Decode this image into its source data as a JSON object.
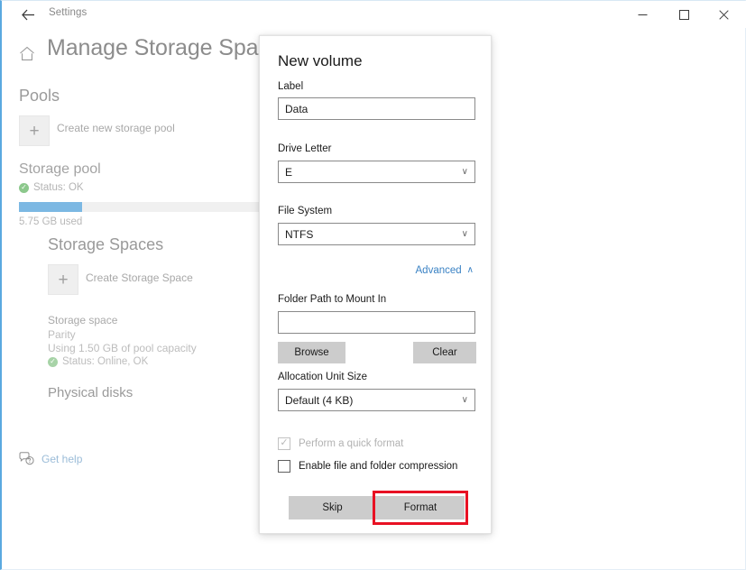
{
  "titlebar": {
    "back_icon": "back-arrow-icon",
    "app_title": "Settings",
    "minimize_label": "–",
    "maximize_label": "□",
    "close_label": "✕"
  },
  "header": {
    "home_icon": "home-icon",
    "page_title": "Manage Storage Spaces"
  },
  "main": {
    "pools_heading": "Pools",
    "create_pool": {
      "plus": "+",
      "label": "Create new storage pool"
    },
    "pool": {
      "name": "Storage pool",
      "status": "Status: OK",
      "status_check": "✓",
      "used_text": "5.75 GB used",
      "used_percent": 25
    },
    "spaces_heading": "Storage Spaces",
    "create_space": {
      "plus": "+",
      "label": "Create Storage Space"
    },
    "space": {
      "name": "Storage space",
      "type": "Parity",
      "capacity": "Using 1.50 GB of pool capacity",
      "status": "Status: Online, OK",
      "status_check": "✓"
    },
    "disks_heading": "Physical disks",
    "get_help": {
      "icon": "help-chat-icon",
      "label": "Get help"
    }
  },
  "dialog": {
    "title": "New volume",
    "label_field": {
      "label": "Label",
      "value": "Data",
      "placeholder": ""
    },
    "drive_letter_field": {
      "label": "Drive Letter",
      "value": "E",
      "chevron": "∨"
    },
    "file_system_field": {
      "label": "File System",
      "value": "NTFS",
      "chevron": "∨"
    },
    "advanced": {
      "label": "Advanced",
      "chevron": "∧"
    },
    "folder_path_field": {
      "label": "Folder Path to Mount In",
      "value": "",
      "placeholder": ""
    },
    "browse_label": "Browse",
    "clear_label": "Clear",
    "allocation_field": {
      "label": "Allocation Unit Size",
      "value": "Default (4 KB)",
      "chevron": "∨"
    },
    "quick_format": {
      "label": "Perform a quick format",
      "checked": true,
      "disabled": true,
      "tick": "✓"
    },
    "compression": {
      "label": "Enable file and folder compression",
      "checked": false,
      "tick": ""
    },
    "skip_label": "Skip",
    "format_label": "Format"
  },
  "colors": {
    "accent_blue": "#5aa9e0",
    "progress_fill": "#7cb8e3",
    "link_blue": "#3a82c4",
    "status_green": "#8cc88c",
    "highlight_red": "#e81123",
    "button_gray": "#cccccc"
  }
}
